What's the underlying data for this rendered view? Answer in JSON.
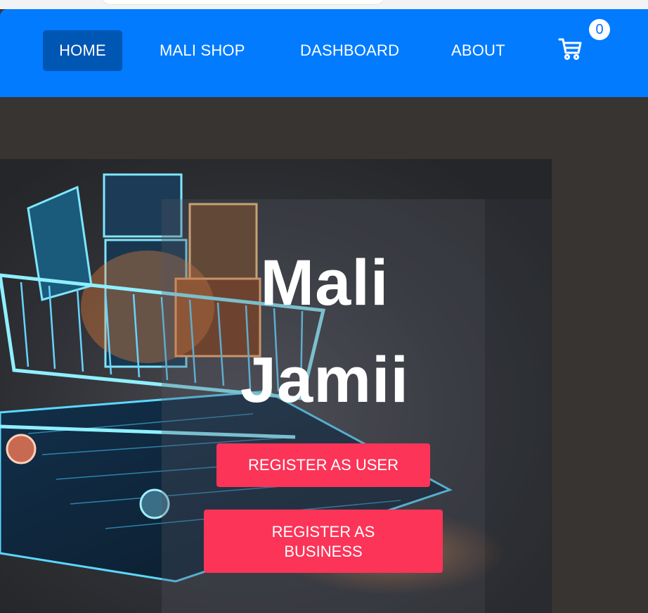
{
  "nav": {
    "items": [
      {
        "label": "HOME",
        "active": true
      },
      {
        "label": "MALI SHOP",
        "active": false
      },
      {
        "label": "DASHBOARD",
        "active": false
      },
      {
        "label": "ABOUT",
        "active": false
      }
    ],
    "cart_count": "0",
    "cart_icon": "shopping-cart-icon"
  },
  "hero": {
    "title_line1": "Mali",
    "title_line2": "Jamii",
    "image": "shopping-cart-on-smartphone-illustration",
    "buttons": {
      "register_user": "REGISTER AS USER",
      "register_business": "REGISTER AS BUSINESS"
    }
  },
  "colors": {
    "navbar": "#027bff",
    "active_nav": "#0056b3",
    "button": "#fb3458",
    "hero_bg": "#383431"
  }
}
